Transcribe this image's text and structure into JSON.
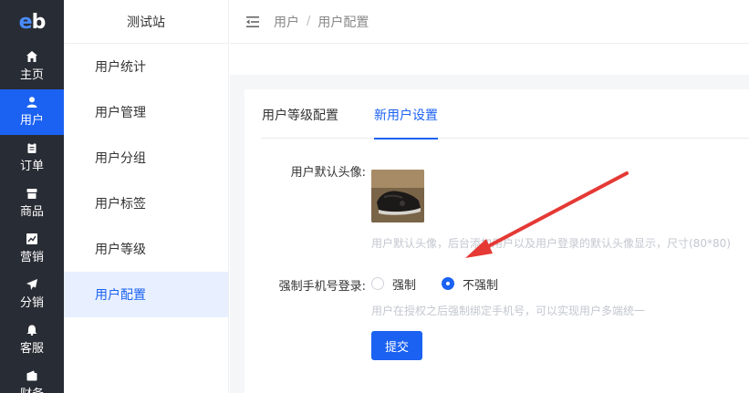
{
  "rail": {
    "logo": {
      "e": "e",
      "b": "b"
    },
    "items": [
      {
        "label": "主页",
        "icon": "home-icon"
      },
      {
        "label": "用户",
        "icon": "user-icon",
        "active": true
      },
      {
        "label": "订单",
        "icon": "clipboard-icon"
      },
      {
        "label": "商品",
        "icon": "shop-icon"
      },
      {
        "label": "营销",
        "icon": "chart-icon"
      },
      {
        "label": "分销",
        "icon": "send-icon"
      },
      {
        "label": "客服",
        "icon": "bell-icon"
      },
      {
        "label": "财务",
        "icon": "wallet-icon"
      }
    ]
  },
  "submenu": {
    "title": "测试站",
    "items": [
      "用户统计",
      "用户管理",
      "用户分组",
      "用户标签",
      "用户等级",
      "用户配置"
    ],
    "active_index": 5
  },
  "header": {
    "breadcrumb": [
      "用户",
      "用户配置"
    ],
    "separator": "/"
  },
  "tabs": [
    {
      "label": "用户等级配置",
      "active": false
    },
    {
      "label": "新用户设置",
      "active": true
    }
  ],
  "form": {
    "avatar_label": "用户默认头像:",
    "avatar_hint": "用户默认头像，后台添加用户以及用户登录的默认头像显示，尺寸(80*80)",
    "phone_label": "强制手机号登录:",
    "phone_options": [
      {
        "label": "强制",
        "checked": false
      },
      {
        "label": "不强制",
        "checked": true
      }
    ],
    "phone_hint": "用户在授权之后强制绑定手机号，可以实现用户多端统一",
    "submit_label": "提交"
  },
  "colors": {
    "accent": "#1b62f2",
    "rail_bg": "#282c34",
    "annotation_arrow": "#e53935"
  }
}
